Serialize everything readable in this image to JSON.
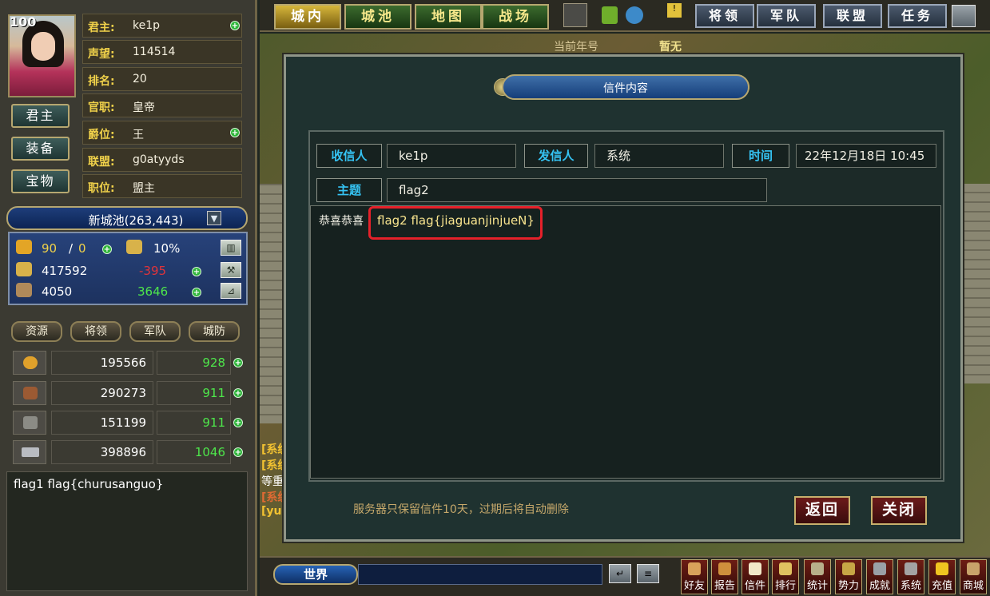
{
  "player": {
    "level": "100",
    "buttons": [
      "君主",
      "装备",
      "宝物"
    ],
    "info": [
      {
        "key": "君主:",
        "value": "ke1p",
        "plus": true
      },
      {
        "key": "声望:",
        "value": "114514",
        "plus": false
      },
      {
        "key": "排名:",
        "value": "20",
        "plus": false
      },
      {
        "key": "官职:",
        "value": "皇帝",
        "plus": false
      },
      {
        "key": "爵位:",
        "value": "王",
        "plus": true
      },
      {
        "key": "联盟:",
        "value": "g0atyyds",
        "plus": false
      },
      {
        "key": "职位:",
        "value": "盟主",
        "plus": false
      }
    ]
  },
  "city": {
    "name": "新城池(263,443)",
    "dropdown_icon": "▼"
  },
  "city_stats": {
    "row1": {
      "a": "90",
      "sep": "/",
      "b": "0",
      "pct": "10%"
    },
    "row2": {
      "value": "417592",
      "delta": "-395"
    },
    "row3": {
      "value": "4050",
      "delta": "3646"
    }
  },
  "tabs": [
    "资源",
    "将领",
    "军队",
    "城防"
  ],
  "resources": [
    {
      "icon": "grain-icon",
      "amount": "195566",
      "rate": "928"
    },
    {
      "icon": "wood-icon",
      "amount": "290273",
      "rate": "911"
    },
    {
      "icon": "stone-icon",
      "amount": "151199",
      "rate": "911"
    },
    {
      "icon": "iron-icon",
      "amount": "398896",
      "rate": "1046"
    }
  ],
  "left_chat": {
    "text": "flag1 flag{churusanguo}"
  },
  "nav": {
    "left": [
      "城内",
      "城池",
      "地图",
      "战场"
    ],
    "right": [
      "将领",
      "军队",
      "联盟",
      "任务"
    ]
  },
  "world": {
    "era_label": "当前年号",
    "era_value": "暂无",
    "sys_lines": [
      "[系统",
      "[系统",
      "等重",
      "[系统",
      "[yu"
    ]
  },
  "letter": {
    "title": "信件内容",
    "recipient_label": "收信人",
    "recipient": "ke1p",
    "sender_label": "发信人",
    "sender": "系统",
    "time_label": "时间",
    "time": "22年12月18日 10:45",
    "subject_label": "主题",
    "subject": "flag2",
    "body_prefix": "恭喜恭喜",
    "body_flag": "flag2 flag{jiaguanjinjueN}",
    "notice": "服务器只保留信件10天，过期后将自动删除",
    "back_label": "返回",
    "close_label": "关闭"
  },
  "bottom": {
    "channel": "世界",
    "icons": [
      "好友",
      "报告",
      "信件",
      "排行",
      "统计",
      "势力",
      "成就",
      "系统",
      "充值",
      "商城"
    ]
  },
  "colors": {
    "accent_gold": "#f1d24a",
    "label_cyan": "#35c3f3",
    "flag_box_red": "#e5212a",
    "positive_green": "#4ee64b",
    "negative_red": "#e0343a"
  }
}
